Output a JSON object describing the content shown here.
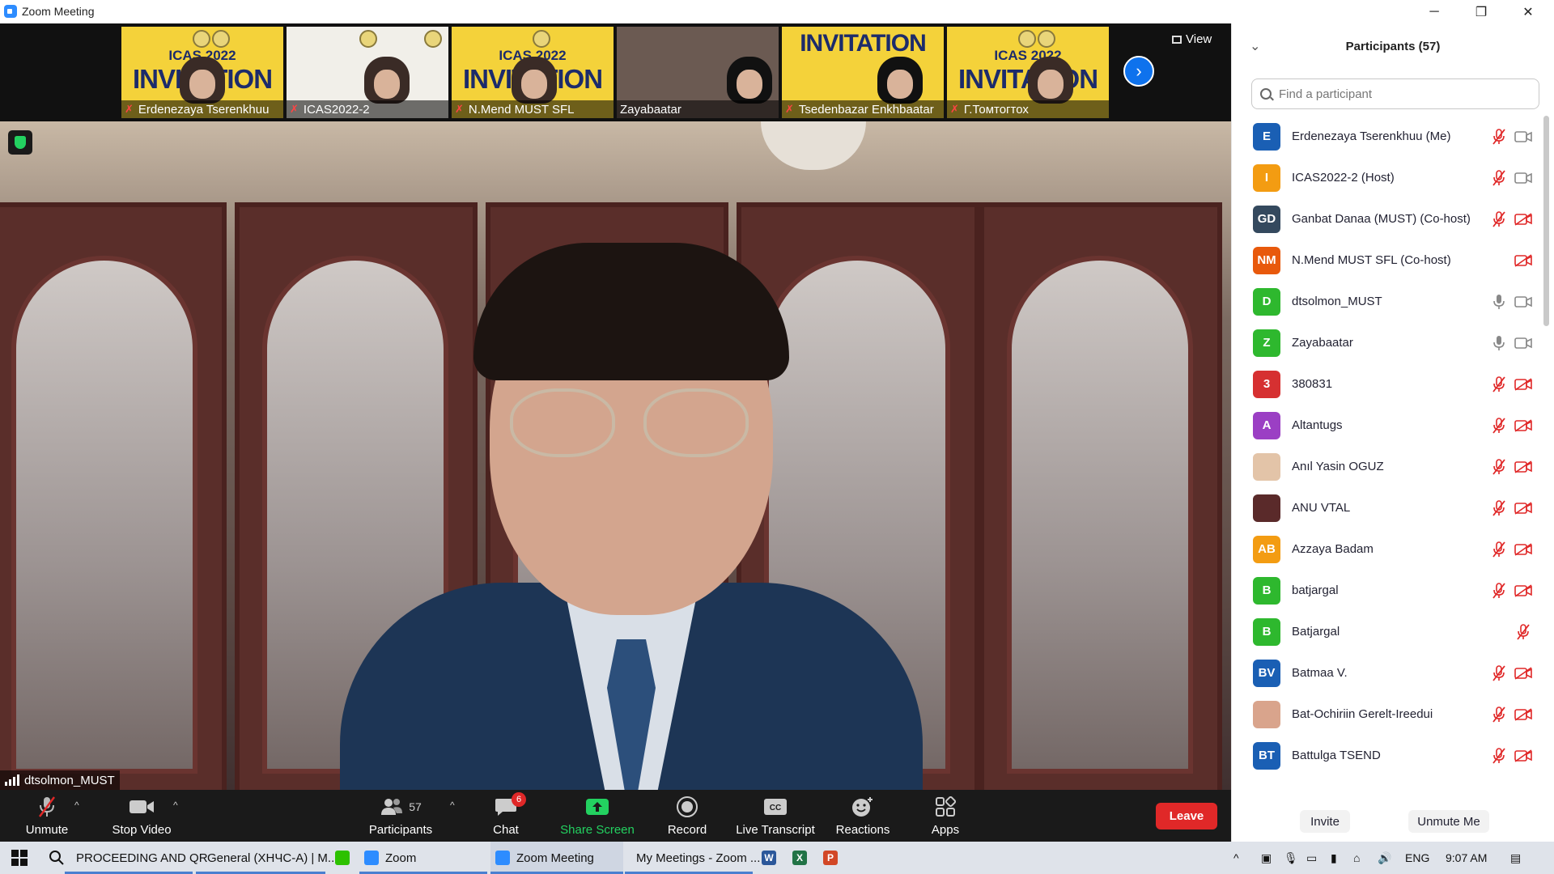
{
  "window": {
    "title": "Zoom Meeting",
    "minimize": "─",
    "restore": "❐",
    "close": "✕"
  },
  "gallery": {
    "thumbnails": [
      {
        "name": "Erdenezaya Tserenkhuu",
        "icas": "ICAS 2022",
        "inv": "INVITATION",
        "muted": true
      },
      {
        "name": "ICAS2022-2",
        "muted": true
      },
      {
        "name": "N.Mend MUST SFL",
        "icas": "ICAS 2022",
        "inv": "INVITATION",
        "muted": true
      },
      {
        "name": "Zayabaatar",
        "muted": false
      },
      {
        "name": "Tsedenbazar Enkhbaatar",
        "inv": "INVITATION",
        "muted": true
      },
      {
        "name": "Г.Томтогтох",
        "icas": "ICAS 2022",
        "inv": "INVITATION",
        "muted": true
      }
    ],
    "view_label": "View"
  },
  "main_video": {
    "speaker_name": "dtsolmon_MUST"
  },
  "toolbar": {
    "unmute": "Unmute",
    "stop_video": "Stop Video",
    "participants": "Participants",
    "participants_count": "57",
    "chat": "Chat",
    "chat_badge": "6",
    "share_screen": "Share Screen",
    "record": "Record",
    "live_transcript": "Live Transcript",
    "reactions": "Reactions",
    "apps": "Apps",
    "leave": "Leave"
  },
  "panel": {
    "title": "Participants (57)",
    "search_placeholder": "Find a participant",
    "invite": "Invite",
    "unmute_me": "Unmute Me",
    "participants": [
      {
        "initials": "E",
        "name": "Erdenezaya Tserenkhuu (Me)",
        "color": "#1a5fb4",
        "mic": "muted",
        "cam": "on"
      },
      {
        "initials": "I",
        "name": "ICAS2022-2 (Host)",
        "color": "#f39c12",
        "mic": "muted",
        "cam": "on"
      },
      {
        "initials": "GD",
        "name": "Ganbat Danaa (MUST) (Co-host)",
        "color": "#34495e",
        "mic": "muted",
        "cam": "off"
      },
      {
        "initials": "NM",
        "name": "N.Mend MUST SFL (Co-host)",
        "color": "#e8590c",
        "mic": "none",
        "cam": "off"
      },
      {
        "initials": "D",
        "name": "dtsolmon_MUST",
        "color": "#2eb82e",
        "mic": "on",
        "cam": "on"
      },
      {
        "initials": "Z",
        "name": "Zayabaatar",
        "color": "#2eb82e",
        "mic": "on",
        "cam": "on"
      },
      {
        "initials": "3",
        "name": "380831",
        "color": "#d63031",
        "mic": "muted",
        "cam": "off"
      },
      {
        "initials": "A",
        "name": "Altantugs",
        "color": "#9b3fc4",
        "mic": "muted",
        "cam": "off"
      },
      {
        "initials": "",
        "name": "Anıl Yasin OGUZ",
        "color": "#e3c4a8",
        "mic": "muted",
        "cam": "off"
      },
      {
        "initials": "",
        "name": "ANU VTAL",
        "color": "#5a2a2a",
        "mic": "muted",
        "cam": "off"
      },
      {
        "initials": "AB",
        "name": "Azzaya Badam",
        "color": "#f39c12",
        "mic": "muted",
        "cam": "off"
      },
      {
        "initials": "B",
        "name": "batjargal",
        "color": "#2eb82e",
        "mic": "muted",
        "cam": "off"
      },
      {
        "initials": "B",
        "name": "Batjargal",
        "color": "#2eb82e",
        "mic": "none",
        "cam": "muted"
      },
      {
        "initials": "BV",
        "name": "Batmaa V.",
        "color": "#1a5fb4",
        "mic": "muted",
        "cam": "off"
      },
      {
        "initials": "",
        "name": "Bat-Ochiriin Gerelt-Ireedui",
        "color": "#d9a48c",
        "mic": "muted",
        "cam": "off"
      },
      {
        "initials": "BT",
        "name": "Battulga TSEND",
        "color": "#1a5fb4",
        "mic": "muted",
        "cam": "off"
      }
    ]
  },
  "taskbar": {
    "items": [
      {
        "label": "PROCEEDING AND  QR",
        "color": "#f4c20d"
      },
      {
        "label": "General (ХНЧС-А) | M...",
        "color": "#5b5fc7"
      },
      {
        "label": "",
        "color": "#2dc100"
      },
      {
        "label": "Zoom",
        "color": "#2d8cff"
      },
      {
        "label": "Zoom Meeting",
        "color": "#2d8cff"
      },
      {
        "label": "My Meetings - Zoom ...",
        "color": "#db4437"
      },
      {
        "label": "W",
        "color": "#2b579a"
      },
      {
        "label": "X",
        "color": "#217346"
      },
      {
        "label": "P",
        "color": "#d24726"
      }
    ],
    "lang": "ENG",
    "time": "9:07 AM"
  }
}
